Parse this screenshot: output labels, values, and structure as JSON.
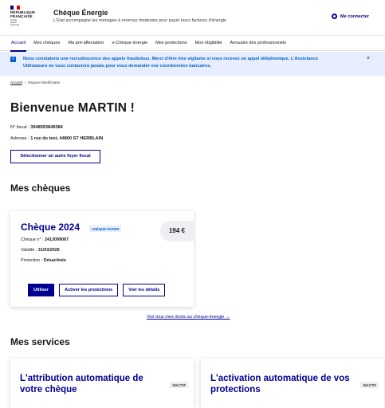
{
  "header": {
    "rf_lines": [
      "RÉPUBLIQUE",
      "FRANÇAISE"
    ],
    "motto_lines": [
      "Liberté",
      "Égalité",
      "Fraternité"
    ],
    "title": "Chèque Énergie",
    "tagline": "L'État accompagne les ménages à revenus modestes pour payer leurs factures d'énergie",
    "login_label": "Me connecter",
    "colors": {
      "blue": "#000091",
      "red": "#e1000f"
    }
  },
  "nav": {
    "items": [
      "Accueil",
      "Mes chèques",
      "Ma pré-affectation",
      "e-Chèque énergie",
      "Mes protections",
      "Mon éligibilité",
      "Annuaire des professionnels"
    ],
    "active_index": 0
  },
  "alert": {
    "icon": "i",
    "text": "Nous constatons une recrudescence des appels frauduleux. Merci d'être très vigilants si vous recevez un appel téléphonique. L'Assistance Utilisateurs ne vous contactera jamais pour vous demander vos coordonnées bancaires.",
    "close": "×"
  },
  "breadcrumb": {
    "home": "Accueil",
    "separator": "›",
    "current": "Espace bénéficiaire"
  },
  "welcome": "Bienvenue MARTIN !",
  "fiscal": {
    "label": "N° fiscal : ",
    "value": "3948593849384"
  },
  "address": {
    "label": "Adresse : ",
    "value": "1 rue du test, 44800 ST HERBLAIN"
  },
  "select_button": "Sélectionner un autre foyer fiscal",
  "cheques_section": {
    "title": "Mes chèques",
    "card": {
      "title": "Chèque 2024",
      "badge": "CHÈQUE PAPIER",
      "amount": "194 €",
      "number_label": "Chèque n° : ",
      "number_value": "2413099067",
      "validity_label": "Validité : ",
      "validity_value": "31/03/2026",
      "protection_label": "Protection : ",
      "protection_value": "Désactivée",
      "buttons": {
        "use": "Utiliser",
        "protect": "Activer les protections",
        "details": "Voir les détails"
      }
    },
    "all_rights_link": "Voir tous mes droits au chèque-énergie →"
  },
  "services_section": {
    "title": "Mes services",
    "cards": [
      {
        "title": "L'attribution automatique de votre chèque",
        "badge": "INACTIF"
      },
      {
        "title": "L'activation automatique de vos protections",
        "badge": "INACTIF"
      }
    ]
  }
}
